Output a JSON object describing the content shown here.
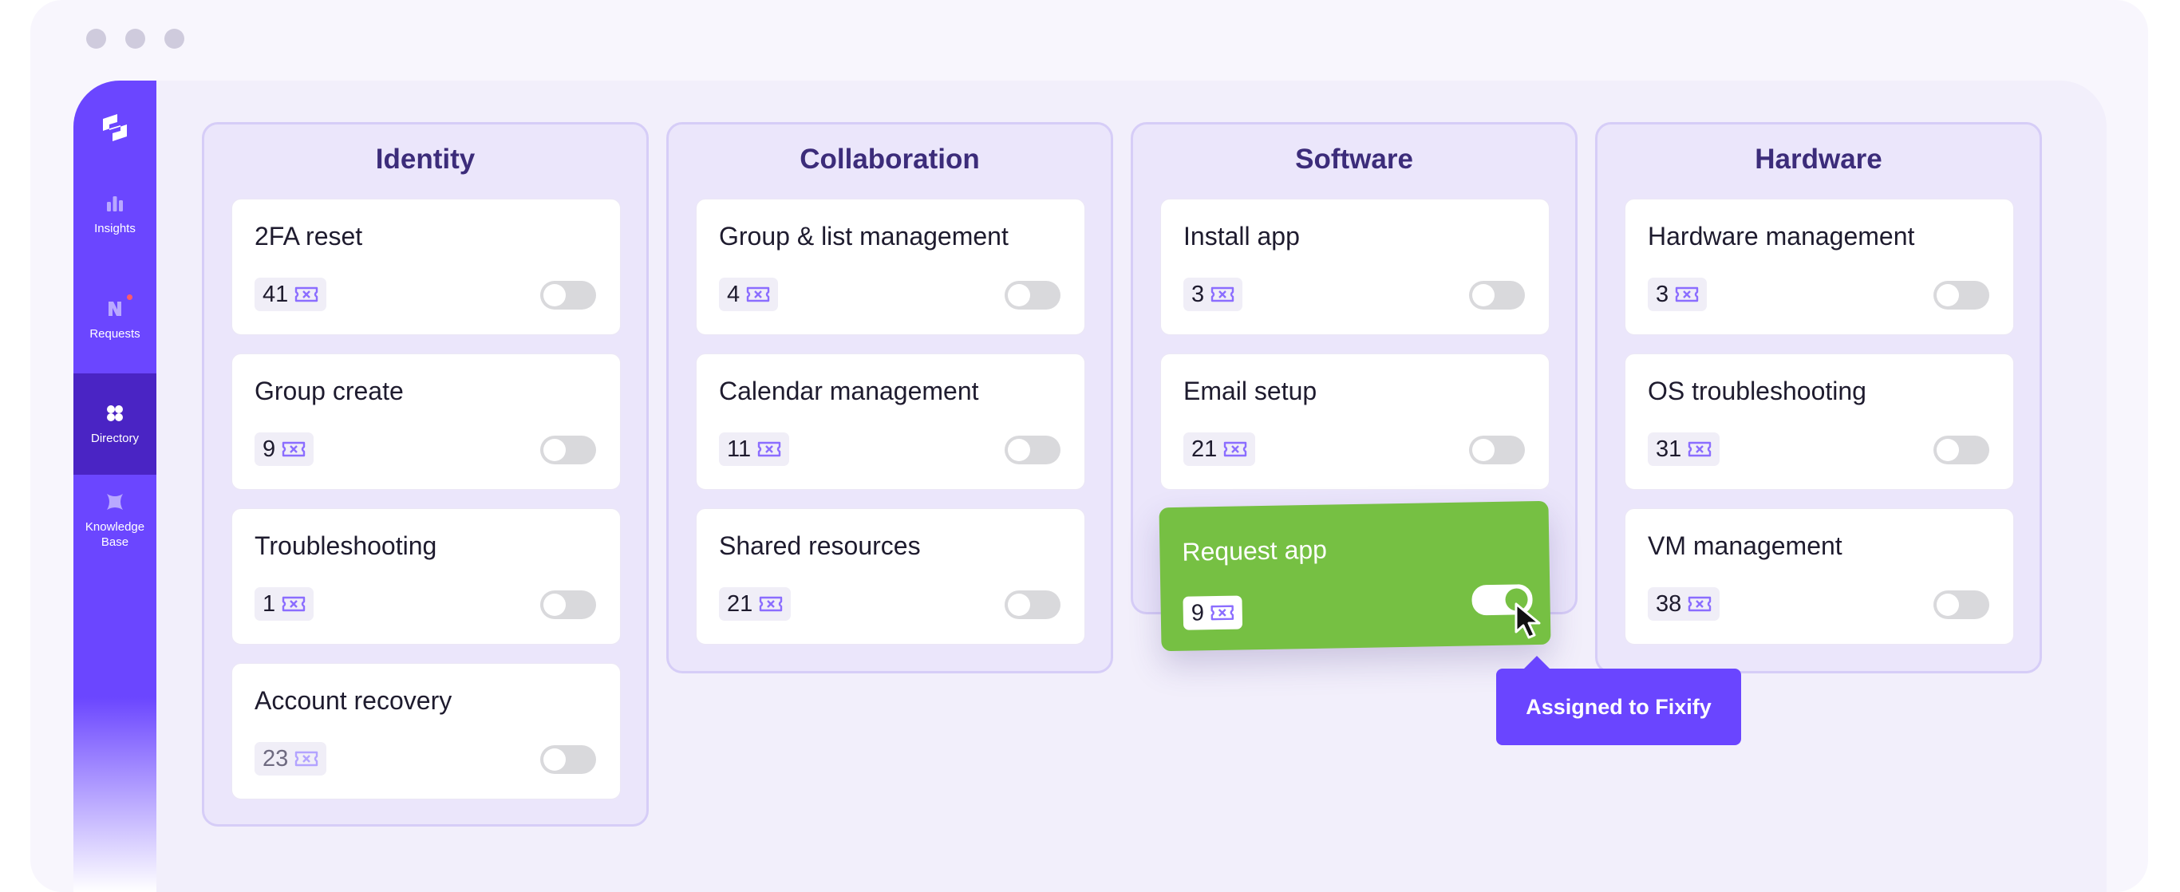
{
  "sidebar": {
    "items": [
      {
        "label": "Insights",
        "icon": "bar-chart-icon"
      },
      {
        "label": "Requests",
        "icon": "requests-icon"
      },
      {
        "label": "Directory",
        "icon": "directory-icon",
        "active": true
      },
      {
        "label": "Knowledge Base",
        "icon": "knowledge-base-icon"
      }
    ]
  },
  "columns": [
    {
      "title": "Identity",
      "cards": [
        {
          "title": "2FA reset",
          "count": "41",
          "enabled": false
        },
        {
          "title": "Group create",
          "count": "9",
          "enabled": false
        },
        {
          "title": "Troubleshooting",
          "count": "1",
          "enabled": false
        },
        {
          "title": "Account recovery",
          "count": "23",
          "enabled": false
        }
      ]
    },
    {
      "title": "Collaboration",
      "cards": [
        {
          "title": "Group & list management",
          "count": "4",
          "enabled": false
        },
        {
          "title": "Calendar management",
          "count": "11",
          "enabled": false
        },
        {
          "title": "Shared resources",
          "count": "21",
          "enabled": false
        }
      ]
    },
    {
      "title": "Software",
      "cards": [
        {
          "title": "Install app",
          "count": "3",
          "enabled": false
        },
        {
          "title": "Email setup",
          "count": "21",
          "enabled": false
        }
      ]
    },
    {
      "title": "Hardware",
      "cards": [
        {
          "title": "Hardware management",
          "count": "3",
          "enabled": false
        },
        {
          "title": "OS troubleshooting",
          "count": "31",
          "enabled": false
        },
        {
          "title": "VM management",
          "count": "38",
          "enabled": false
        }
      ]
    }
  ],
  "dragged_card": {
    "title": "Request app",
    "count": "9",
    "enabled": true
  },
  "tooltip": {
    "text": "Assigned to Fixify"
  },
  "colors": {
    "accent": "#6b46ff",
    "active_nav": "#4a24c4",
    "success": "#76c043",
    "column_bg": "#ebe6fb",
    "title_text": "#3c2c7a"
  }
}
